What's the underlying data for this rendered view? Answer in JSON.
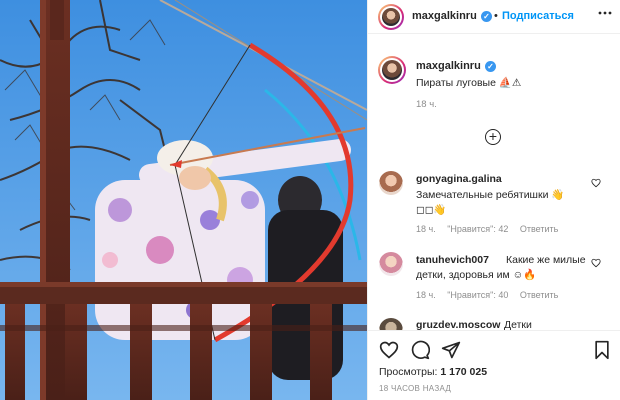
{
  "post": {
    "author": "maxgalkinru",
    "follow_label": "Подписаться",
    "separator": "•",
    "more_icon": "more-horizontal-icon",
    "caption": "Пираты луговые ⛵⚠",
    "caption_time": "18 ч."
  },
  "comments": [
    {
      "user": "gonyagina.galina",
      "text_line1": "Замечательные ребятишки 👋",
      "text_line2": "◻◻👋",
      "time": "18 ч.",
      "likes": "\"Нравится\": 42",
      "reply": "Ответить"
    },
    {
      "user": "tanuhevich007",
      "text_line1": "Какие же милые",
      "text_line2": "детки, здоровья им ☺🔥",
      "time": "18 ч.",
      "likes": "\"Нравится\": 40",
      "reply": "Ответить"
    },
    {
      "user": "gruzdev.moscow",
      "text_line1": "Детки"
    }
  ],
  "footer": {
    "views_label": "Просмотры:",
    "views_count": "1 170 025",
    "posted_ago": "18 ЧАСОВ НАЗАД"
  },
  "colors": {
    "accent": "#0095f6",
    "verified": "#3897f0",
    "muted": "#8e8e8e",
    "sky": "#4f9fe6",
    "bow": "#e23a2e"
  }
}
